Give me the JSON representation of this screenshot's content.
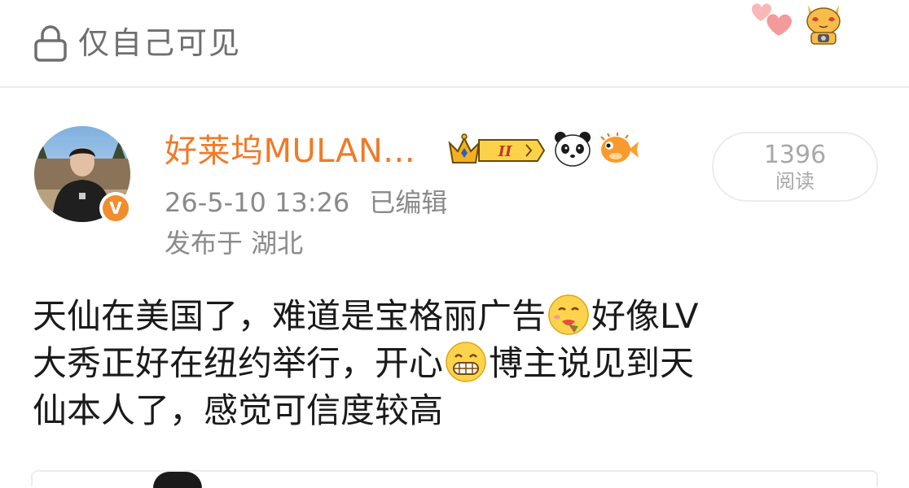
{
  "top_bar": {
    "visibility_text": "仅自己可见",
    "lock_icon": "lock-icon",
    "decoration_icons": [
      "hearts-icon",
      "cat-sticker-icon"
    ]
  },
  "post_header": {
    "username": "好莱坞MULAN...",
    "badges": [
      "crown-level-ii-badge",
      "panda-icon",
      "pufferfish-icon"
    ],
    "crown_level": "II",
    "verified_badge": "V",
    "timestamp": "26-5-10 13:26",
    "edited_label": "已编辑",
    "location": "发布于 湖北",
    "read_count": "1396",
    "read_label": "阅读"
  },
  "post_body": {
    "lines": [
      [
        "天仙在美国了，难道是宝格丽广告",
        "{emoji:yummy}",
        "好像LV"
      ],
      [
        "大秀正好在纽约举行，开心",
        "{emoji:grin}",
        "博主说见到天"
      ],
      [
        "仙本人了，感觉可信度较高"
      ]
    ],
    "segments": {
      "l1a": "天仙在美国了，难道是宝格丽广告",
      "l1b": "好像LV",
      "l2a": "大秀正好在纽约举行，开心",
      "l2b": "博主说见到天",
      "l3": "仙本人了，感觉可信度较高"
    },
    "emojis": [
      "yummy-emoji",
      "grin-emoji"
    ]
  },
  "colors": {
    "username": "#f07b27",
    "meta_gray": "#8a8a8a",
    "verified": "#f08d2c",
    "text": "#1a1a1a"
  }
}
